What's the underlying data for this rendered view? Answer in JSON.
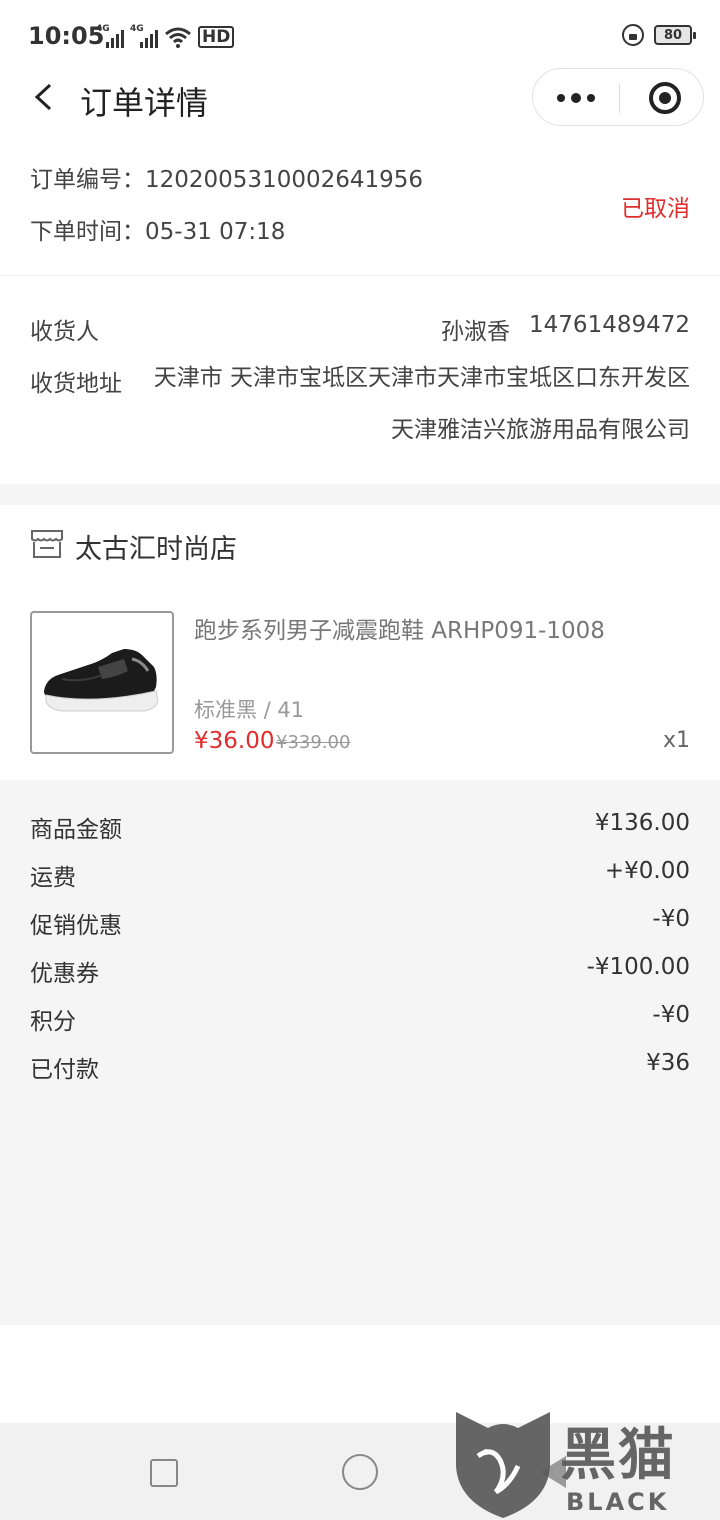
{
  "status_bar": {
    "time": "10:05",
    "net1": "4G",
    "net2": "4G",
    "hd": "HD",
    "battery": "80"
  },
  "nav": {
    "title": "订单详情",
    "more_icon": "more-dots-icon",
    "close_icon": "target-close-icon"
  },
  "order": {
    "no_label": "订单编号：",
    "no_value": "1202005310002641956",
    "time_label": "下单时间：",
    "time_value": "05-31 07:18",
    "status": "已取消"
  },
  "receiver": {
    "name_label": "收货人",
    "name": "孙淑香",
    "phone": "14761489472",
    "addr_label": "收货地址",
    "addr": "天津市 天津市宝坻区天津市天津市宝坻区口东开发区天津雅洁兴旅游用品有限公司"
  },
  "shop": {
    "name": "太古汇时尚店",
    "icon": "store-icon"
  },
  "product": {
    "title": "跑步系列男子减震跑鞋   ARHP091-1008",
    "sku": "标准黑 / 41",
    "price": "¥36.00",
    "orig_price": "¥339.00",
    "qty": "x1"
  },
  "summary": [
    {
      "label": "商品金额",
      "value": "¥136.00"
    },
    {
      "label": "运费",
      "value": "+¥0.00"
    },
    {
      "label": "促销优惠",
      "value": "-¥0"
    },
    {
      "label": "优惠券",
      "value": "-¥100.00"
    },
    {
      "label": "积分",
      "value": "-¥0"
    },
    {
      "label": "已付款",
      "value": "¥36"
    }
  ],
  "watermark": {
    "cn": "黑猫",
    "en": "BLACK CAT"
  },
  "colors": {
    "accent_red": "#e02d2d",
    "summary_bg": "#f5f5f5"
  }
}
